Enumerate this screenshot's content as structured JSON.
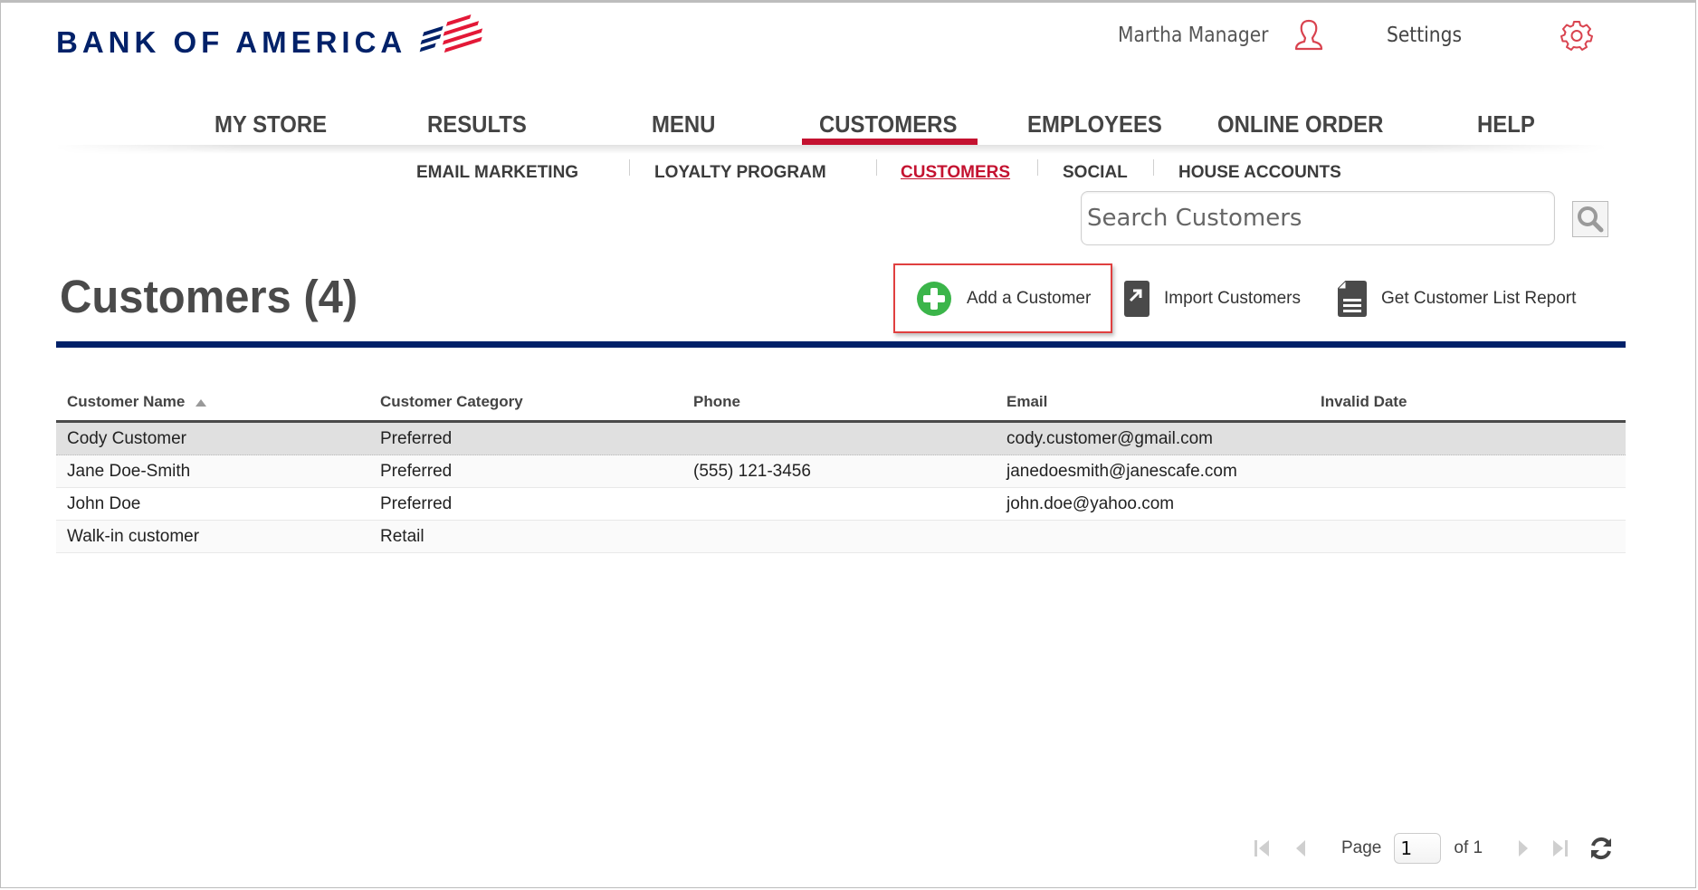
{
  "brand": {
    "name": "BANK OF AMERICA",
    "flag_colors": {
      "navy": "#012169",
      "red": "#e31837"
    }
  },
  "header": {
    "user_name": "Martha Manager",
    "user_icon": "person-icon",
    "settings_label": "Settings",
    "settings_icon": "gear-icon",
    "accent_color": "#d9434f"
  },
  "main_nav": {
    "items": [
      {
        "label": "MY STORE",
        "active": false
      },
      {
        "label": "RESULTS",
        "active": false
      },
      {
        "label": "MENU",
        "active": false
      },
      {
        "label": "CUSTOMERS",
        "active": true
      },
      {
        "label": "EMPLOYEES",
        "active": false
      },
      {
        "label": "ONLINE ORDER",
        "active": false
      },
      {
        "label": "HELP",
        "active": false
      }
    ],
    "active_color": "#c41230"
  },
  "sub_nav": {
    "items": [
      {
        "label": "EMAIL MARKETING",
        "active": false
      },
      {
        "label": "LOYALTY PROGRAM",
        "active": false
      },
      {
        "label": "CUSTOMERS",
        "active": true
      },
      {
        "label": "SOCIAL",
        "active": false
      },
      {
        "label": "HOUSE ACCOUNTS",
        "active": false
      }
    ]
  },
  "search": {
    "placeholder": "Search Customers",
    "value": "",
    "icon": "magnifier-icon"
  },
  "page": {
    "title": "Customers (4)",
    "actions": [
      {
        "label": "Add a Customer",
        "icon": "plus-circle-icon",
        "highlighted": true
      },
      {
        "label": "Import Customers",
        "icon": "import-arrow-icon"
      },
      {
        "label": "Get Customer List Report",
        "icon": "report-document-icon"
      }
    ]
  },
  "table": {
    "columns": [
      "Customer Name",
      "Customer Category",
      "Phone",
      "Email",
      "Invalid Date"
    ],
    "sort": {
      "column": "Customer Name",
      "direction": "ascending"
    },
    "rows": [
      {
        "name": "Cody Customer",
        "category": "Preferred",
        "phone": "",
        "email": "cody.customer@gmail.com",
        "invalid_date": "",
        "selected": true
      },
      {
        "name": "Jane Doe-Smith",
        "category": "Preferred",
        "phone": "(555) 121-3456",
        "email": "janedoesmith@janescafe.com",
        "invalid_date": ""
      },
      {
        "name": "John Doe",
        "category": "Preferred",
        "phone": "",
        "email": "john.doe@yahoo.com",
        "invalid_date": ""
      },
      {
        "name": "Walk-in customer",
        "category": "Retail",
        "phone": "",
        "email": "",
        "invalid_date": ""
      }
    ]
  },
  "pagination": {
    "page_label": "Page",
    "current_page": "1",
    "of_label": "of 1",
    "total_pages": 1
  }
}
